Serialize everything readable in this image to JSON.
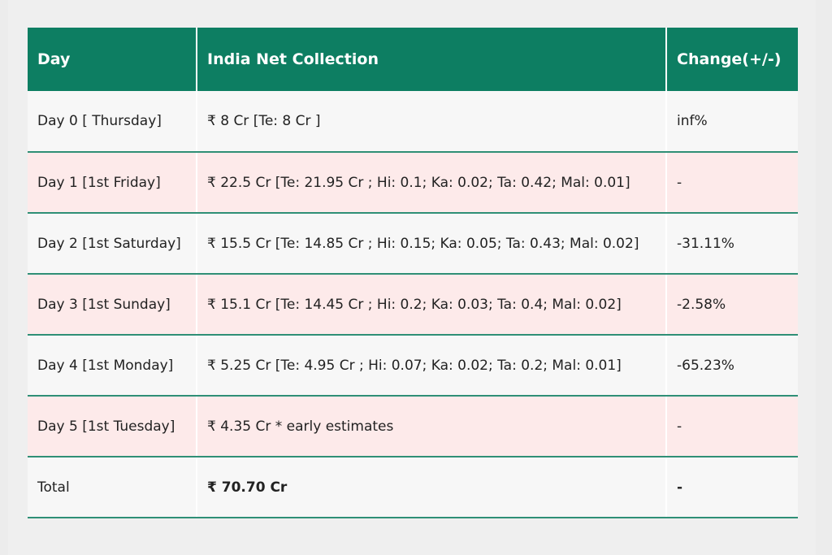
{
  "table": {
    "headers": [
      "Day",
      "India Net Collection",
      "Change(+/-)"
    ],
    "rows": [
      {
        "day": "Day 0 [ Thursday]",
        "collection": "₹ 8 Cr [Te: 8 Cr ]",
        "change": "inf%"
      },
      {
        "day": "Day 1 [1st Friday]",
        "collection": "₹ 22.5 Cr [Te: 21.95 Cr ; Hi: 0.1; Ka: 0.02; Ta: 0.42; Mal: 0.01]",
        "change": "-"
      },
      {
        "day": "Day 2 [1st Saturday]",
        "collection": "₹ 15.5 Cr [Te: 14.85 Cr ; Hi: 0.15; Ka: 0.05; Ta: 0.43; Mal: 0.02]",
        "change": "-31.11%"
      },
      {
        "day": "Day 3 [1st Sunday]",
        "collection": "₹ 15.1 Cr [Te: 14.45 Cr ; Hi: 0.2; Ka: 0.03; Ta: 0.4; Mal: 0.02]",
        "change": "-2.58%"
      },
      {
        "day": "Day 4 [1st Monday]",
        "collection": "₹ 5.25 Cr [Te: 4.95 Cr ; Hi: 0.07; Ka: 0.02; Ta: 0.2; Mal: 0.01]",
        "change": "-65.23%"
      },
      {
        "day": "Day 5 [1st Tuesday]",
        "collection": "₹ 4.35 Cr * early estimates",
        "change": "-"
      }
    ],
    "total": {
      "label": "Total",
      "collection": "₹ 70.70 Cr",
      "change": "-"
    }
  },
  "colors": {
    "header_bg": "#0d7e62",
    "row_alt_bg": "#fdeaea",
    "row_bg": "#f7f7f7",
    "divider": "#2f8f76"
  }
}
